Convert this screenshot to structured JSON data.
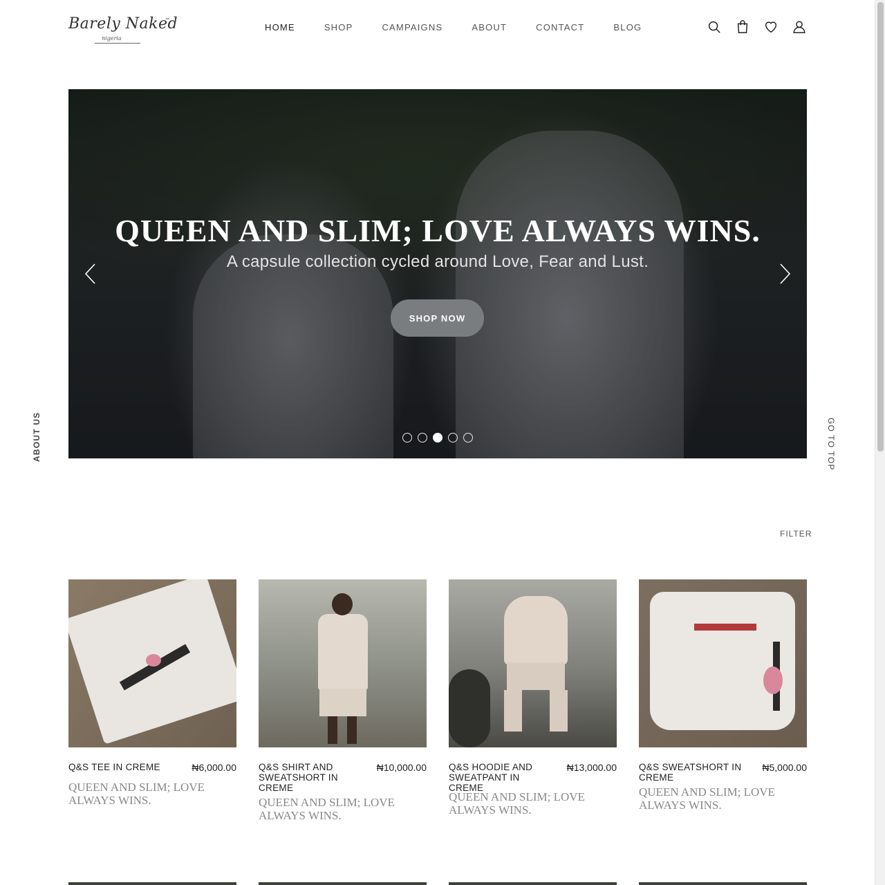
{
  "header": {
    "logo": {
      "main": "Barely Naked",
      "tm": "™",
      "sub": "nigeria"
    },
    "nav": [
      "HOME",
      "SHOP",
      "CAMPAIGNS",
      "ABOUT",
      "CONTACT",
      "BLOG"
    ],
    "active_nav": "HOME",
    "icons": [
      "search-icon",
      "shopping-bag-icon",
      "heart-icon",
      "user-icon"
    ]
  },
  "hero": {
    "title": "QUEEN AND SLIM; LOVE ALWAYS WINS.",
    "subtitle": "A capsule collection cycled around Love, Fear and Lust.",
    "button": "SHOP NOW",
    "slide_count": 5,
    "active_slide": 3
  },
  "side": {
    "left": "ABOUT US",
    "right": "GO TO TOP"
  },
  "filter": "FILTER",
  "products": [
    {
      "name": "Q&S TEE IN CREME",
      "price": "₦6,000.00",
      "desc": "QUEEN AND SLIM; LOVE ALWAYS WINS."
    },
    {
      "name": "Q&S SHIRT AND SWEATSHORT IN CREME",
      "price": "₦10,000.00",
      "desc": "QUEEN AND SLIM; LOVE ALWAYS WINS."
    },
    {
      "name": "Q&S HOODIE AND SWEATPANT IN CREME",
      "price": "₦13,000.00",
      "desc": "QUEEN AND SLIM; LOVE ALWAYS WINS."
    },
    {
      "name": "Q&S SWEATSHORT IN CREME",
      "price": "₦5,000.00",
      "desc": "QUEEN AND SLIM; LOVE ALWAYS WINS."
    }
  ],
  "colors": {
    "accent_button": "#7a7d80",
    "text_muted": "#888888",
    "text_dark": "#222222"
  }
}
